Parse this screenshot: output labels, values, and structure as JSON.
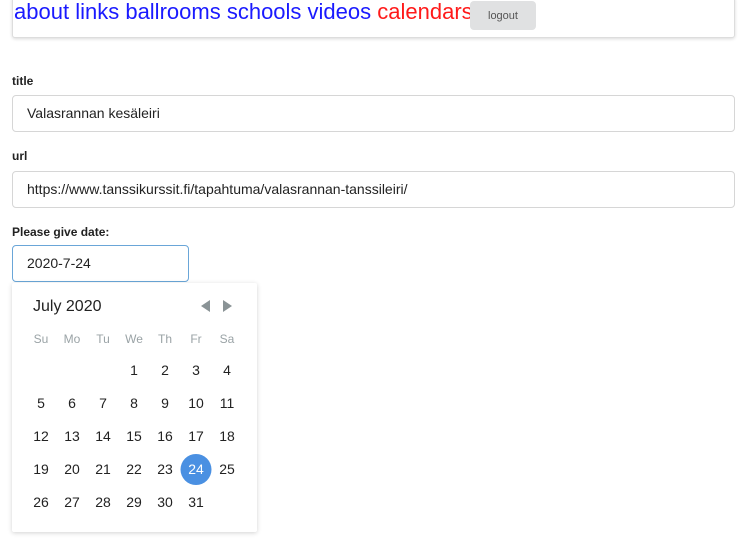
{
  "nav": {
    "links": [
      {
        "label": "about",
        "active": false
      },
      {
        "label": "links",
        "active": false
      },
      {
        "label": "ballrooms",
        "active": false
      },
      {
        "label": "schools",
        "active": false
      },
      {
        "label": "videos",
        "active": false
      },
      {
        "label": "calendars",
        "active": true
      }
    ],
    "logout_label": "logout"
  },
  "form": {
    "title_label": "title",
    "title_value": "Valasrannan kesäleiri",
    "url_label": "url",
    "url_value": "https://www.tanssikurssit.fi/tapahtuma/valasrannan-tanssileiri/",
    "date_label": "Please give date:",
    "date_value": "2020-7-24"
  },
  "calendar": {
    "month_label": "July 2020",
    "weekdays": [
      "Su",
      "Mo",
      "Tu",
      "We",
      "Th",
      "Fr",
      "Sa"
    ],
    "weeks": [
      [
        "",
        "",
        "",
        "1",
        "2",
        "3",
        "4"
      ],
      [
        "5",
        "6",
        "7",
        "8",
        "9",
        "10",
        "11"
      ],
      [
        "12",
        "13",
        "14",
        "15",
        "16",
        "17",
        "18"
      ],
      [
        "19",
        "20",
        "21",
        "22",
        "23",
        "24",
        "25"
      ],
      [
        "26",
        "27",
        "28",
        "29",
        "30",
        "31",
        ""
      ]
    ],
    "selected": "24",
    "accent": "#4a90e2"
  }
}
